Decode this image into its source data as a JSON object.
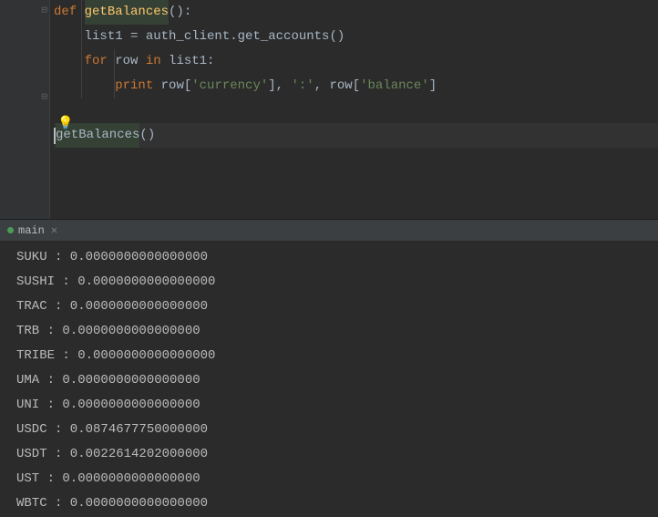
{
  "code": {
    "lines": [
      {
        "indent": 0,
        "tokens": [
          {
            "t": "kw",
            "v": "def "
          },
          {
            "t": "fn-def",
            "v": "getBalances"
          },
          {
            "t": "ident",
            "v": "():"
          }
        ]
      },
      {
        "indent": 1,
        "tokens": [
          {
            "t": "ident",
            "v": "list1 = auth_client.get_accounts()"
          }
        ]
      },
      {
        "indent": 1,
        "tokens": [
          {
            "t": "kw",
            "v": "for "
          },
          {
            "t": "ident",
            "v": "row "
          },
          {
            "t": "kw",
            "v": "in "
          },
          {
            "t": "ident",
            "v": "list1:"
          }
        ]
      },
      {
        "indent": 2,
        "tokens": [
          {
            "t": "kw",
            "v": "print "
          },
          {
            "t": "ident",
            "v": "row["
          },
          {
            "t": "str",
            "v": "'currency'"
          },
          {
            "t": "ident",
            "v": "], "
          },
          {
            "t": "str",
            "v": "':'"
          },
          {
            "t": "ident",
            "v": ", row["
          },
          {
            "t": "str",
            "v": "'balance'"
          },
          {
            "t": "ident",
            "v": "]"
          }
        ]
      },
      {
        "indent": 0,
        "tokens": []
      },
      {
        "indent": 0,
        "cursor": true,
        "tokens": [
          {
            "t": "fn-call",
            "v": "getBalances"
          },
          {
            "t": "ident",
            "v": "()"
          }
        ]
      },
      {
        "indent": 0,
        "tokens": []
      }
    ],
    "fold_marker_top": "⊟",
    "fold_marker_mid": "⊟",
    "bulb": "💡"
  },
  "tab": {
    "label": "main",
    "close": "✕"
  },
  "console_output": [
    "SUKU : 0.0000000000000000",
    "SUSHI : 0.0000000000000000",
    "TRAC : 0.0000000000000000",
    "TRB : 0.0000000000000000",
    "TRIBE : 0.0000000000000000",
    "UMA : 0.0000000000000000",
    "UNI : 0.0000000000000000",
    "USDC : 0.0874677750000000",
    "USDT : 0.0022614202000000",
    "UST : 0.0000000000000000",
    "WBTC : 0.0000000000000000"
  ]
}
